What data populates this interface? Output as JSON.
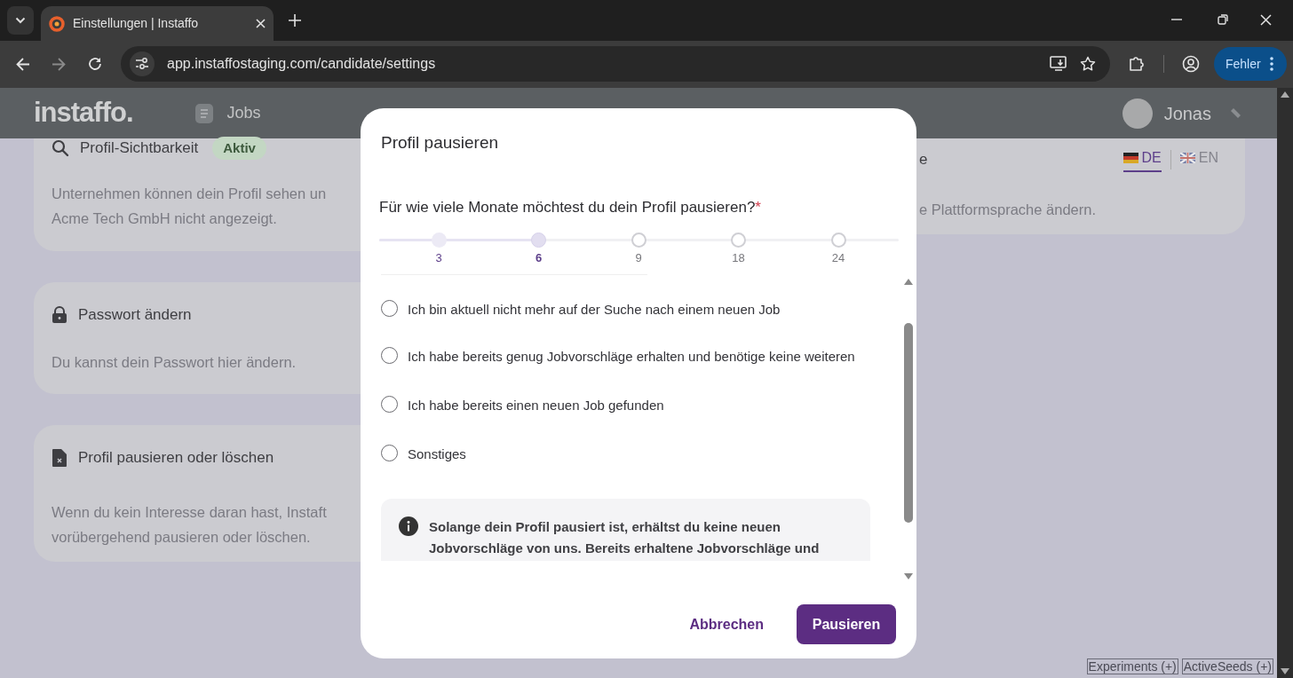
{
  "browser": {
    "tab_title": "Einstellungen | Instaffo",
    "url": "app.instaffostaging.com/candidate/settings",
    "profile_button": "Fehler"
  },
  "app_header": {
    "logo": "instaffo.",
    "nav": [
      {
        "label": "Jobs"
      }
    ],
    "user_name": "Jonas"
  },
  "settings_cards": [
    {
      "kind": "search",
      "title": "Profil-Sichtbarkeit",
      "badge": "Aktiv",
      "description_lines": [
        "Unternehmen können dein Profil sehen un",
        "Acme Tech GmbH nicht angezeigt."
      ]
    },
    {
      "kind": "lock",
      "title": "Passwort ändern",
      "description_lines": [
        "Du kannst dein Passwort hier ändern."
      ]
    },
    {
      "kind": "file",
      "title": "Profil pausieren oder löschen",
      "description_lines": [
        "Wenn du kein Interesse daran hast, Instaft",
        "vorübergehend pausieren oder löschen."
      ]
    }
  ],
  "language_card": {
    "title": "e",
    "description": "e Plattformsprache ändern.",
    "languages": [
      {
        "kind": "de",
        "code": "DE",
        "selected": true
      },
      {
        "kind": "en",
        "code": "EN",
        "selected": false
      }
    ]
  },
  "dialog": {
    "title": "Profil pausieren",
    "question": "Für wie viele Monate möchtest du dein Profil pausieren?",
    "required_mark": "*",
    "durations": [
      {
        "label": "3",
        "selected": false
      },
      {
        "label": "6",
        "selected": true
      },
      {
        "label": "9",
        "selected": false
      },
      {
        "label": "18",
        "selected": false
      },
      {
        "label": "24",
        "selected": false
      }
    ],
    "reasons": [
      {
        "label": "Ich bin aktuell nicht mehr auf der Suche nach einem neuen Job",
        "selected": false
      },
      {
        "label": "Ich habe bereits genug Jobvorschläge erhalten und benötige keine weiteren",
        "selected": false
      },
      {
        "label": "Ich habe bereits einen neuen Job gefunden",
        "selected": false
      },
      {
        "label": "Sonstiges",
        "selected": false
      }
    ],
    "info": "Solange dein Profil pausiert ist, erhältst du keine neuen Jobvorschläge von uns. Bereits erhaltene Jobvorschläge und",
    "cancel_button": "Abbrechen",
    "confirm_button": "Pausieren"
  },
  "debug_buttons": [
    "Experiments (+)",
    "ActiveSeeds (+)"
  ]
}
